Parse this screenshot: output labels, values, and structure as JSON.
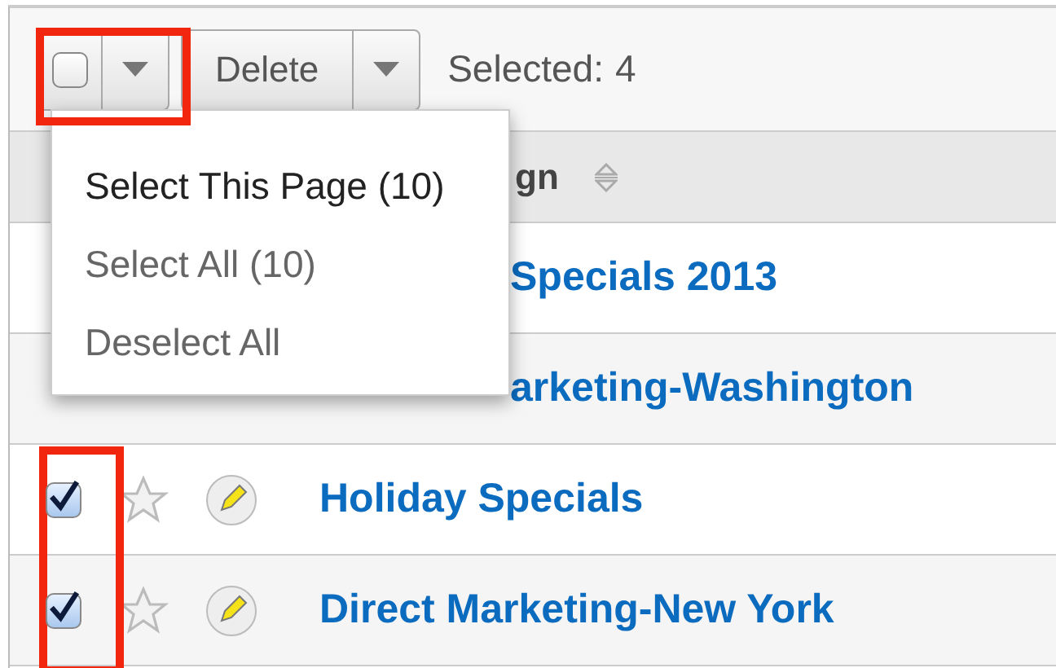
{
  "toolbar": {
    "select_all_checked": false,
    "action_button": "Delete",
    "selected_label": "Selected:",
    "selected_count": "4"
  },
  "header": {
    "column_label": "gn"
  },
  "menu": [
    {
      "label": "Select This Page (10)",
      "highlighted": true
    },
    {
      "label": "Select All (10)",
      "highlighted": false
    },
    {
      "label": "Deselect All",
      "highlighted": false
    }
  ],
  "rows": [
    {
      "kind": "partial",
      "name": "Specials 2013"
    },
    {
      "kind": "partial",
      "name": "arketing-Washington"
    },
    {
      "kind": "full",
      "name": "Holiday Specials",
      "checked": true
    },
    {
      "kind": "full",
      "name": "Direct Marketing-New York",
      "checked": true
    }
  ]
}
